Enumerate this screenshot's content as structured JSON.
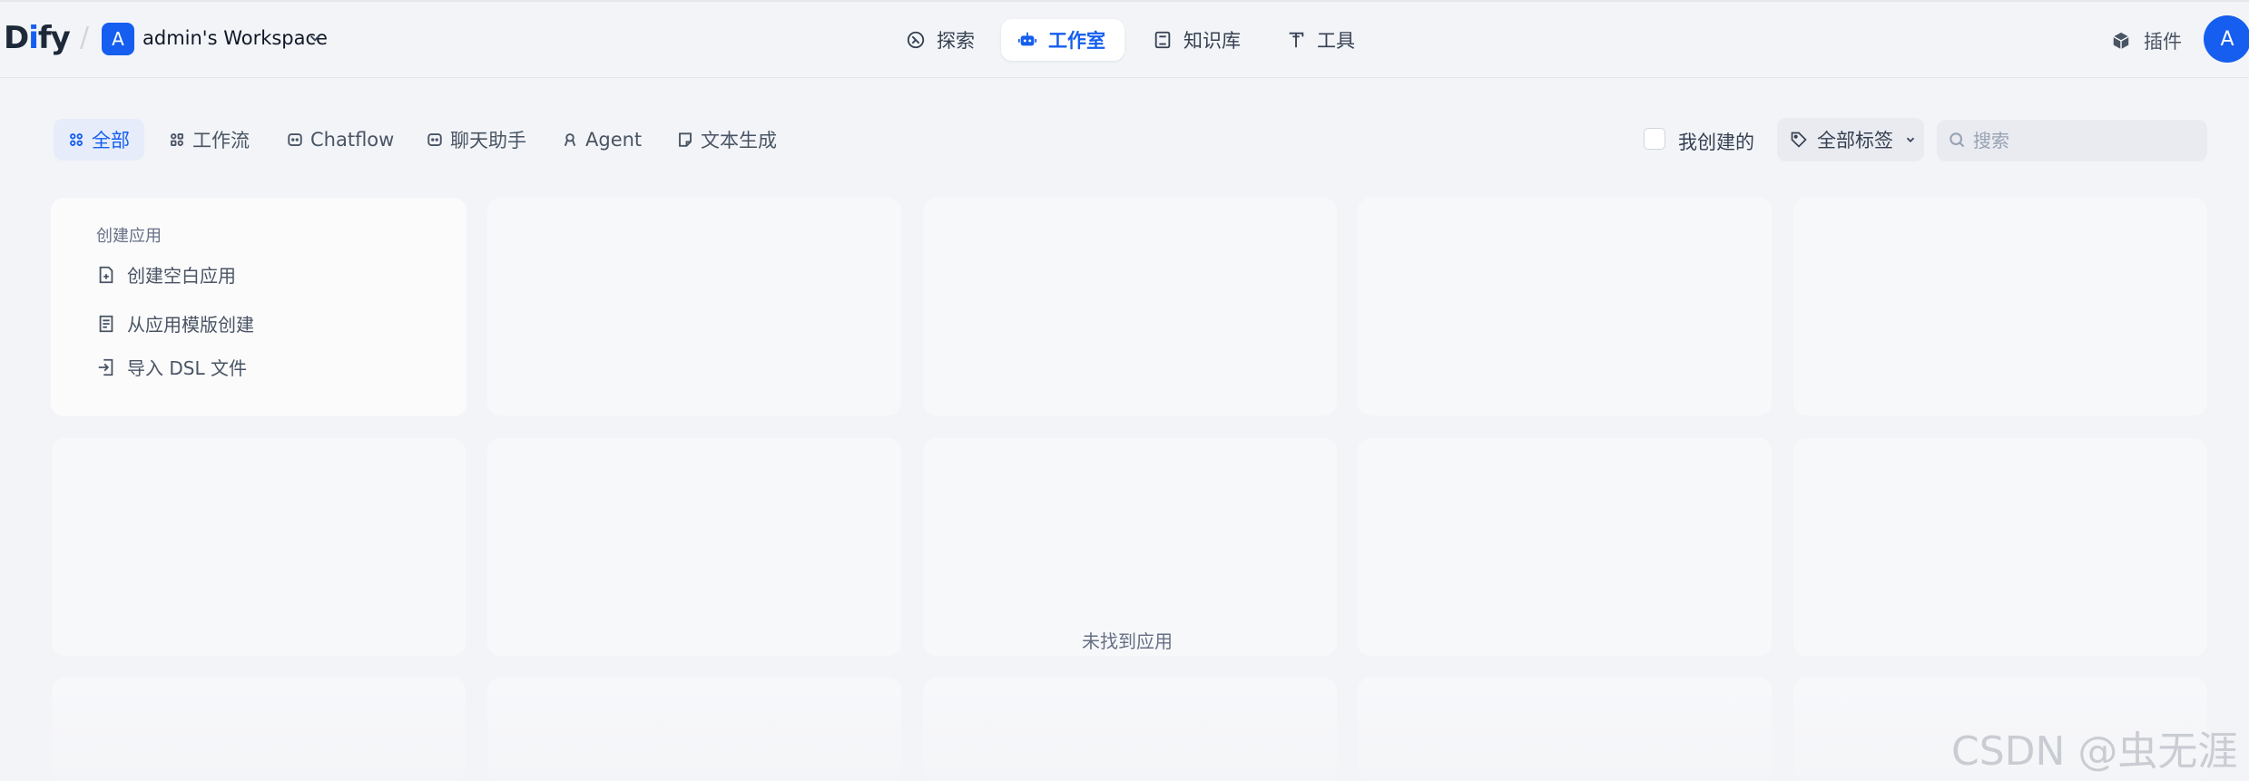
{
  "header": {
    "logo_prefix": "D",
    "logo_i": "i",
    "logo_suffix": "fy",
    "workspace_initial": "A",
    "workspace_name": "admin's Workspace",
    "nav": [
      {
        "label": "探索",
        "icon": "compass-icon"
      },
      {
        "label": "工作室",
        "icon": "robot-icon",
        "active": true
      },
      {
        "label": "知识库",
        "icon": "book-icon"
      },
      {
        "label": "工具",
        "icon": "hammer-icon"
      }
    ],
    "plugin_label": "插件",
    "user_initial": "A"
  },
  "filters": {
    "tabs": [
      {
        "label": "全部",
        "active": true
      },
      {
        "label": "工作流"
      },
      {
        "label": "Chatflow"
      },
      {
        "label": "聊天助手"
      },
      {
        "label": "Agent"
      },
      {
        "label": "文本生成"
      }
    ],
    "mine_label": "我创建的",
    "tags_label": "全部标签",
    "search_placeholder": "搜索"
  },
  "create_card": {
    "title": "创建应用",
    "items": [
      {
        "label": "创建空白应用"
      },
      {
        "label": "从应用模版创建"
      },
      {
        "label": "导入 DSL 文件"
      }
    ]
  },
  "empty_state": "未找到应用",
  "watermark": "CSDN @虫无涯",
  "colors": {
    "accent": "#155eef",
    "background": "#f2f4f7",
    "card": "#f7f8fa"
  }
}
